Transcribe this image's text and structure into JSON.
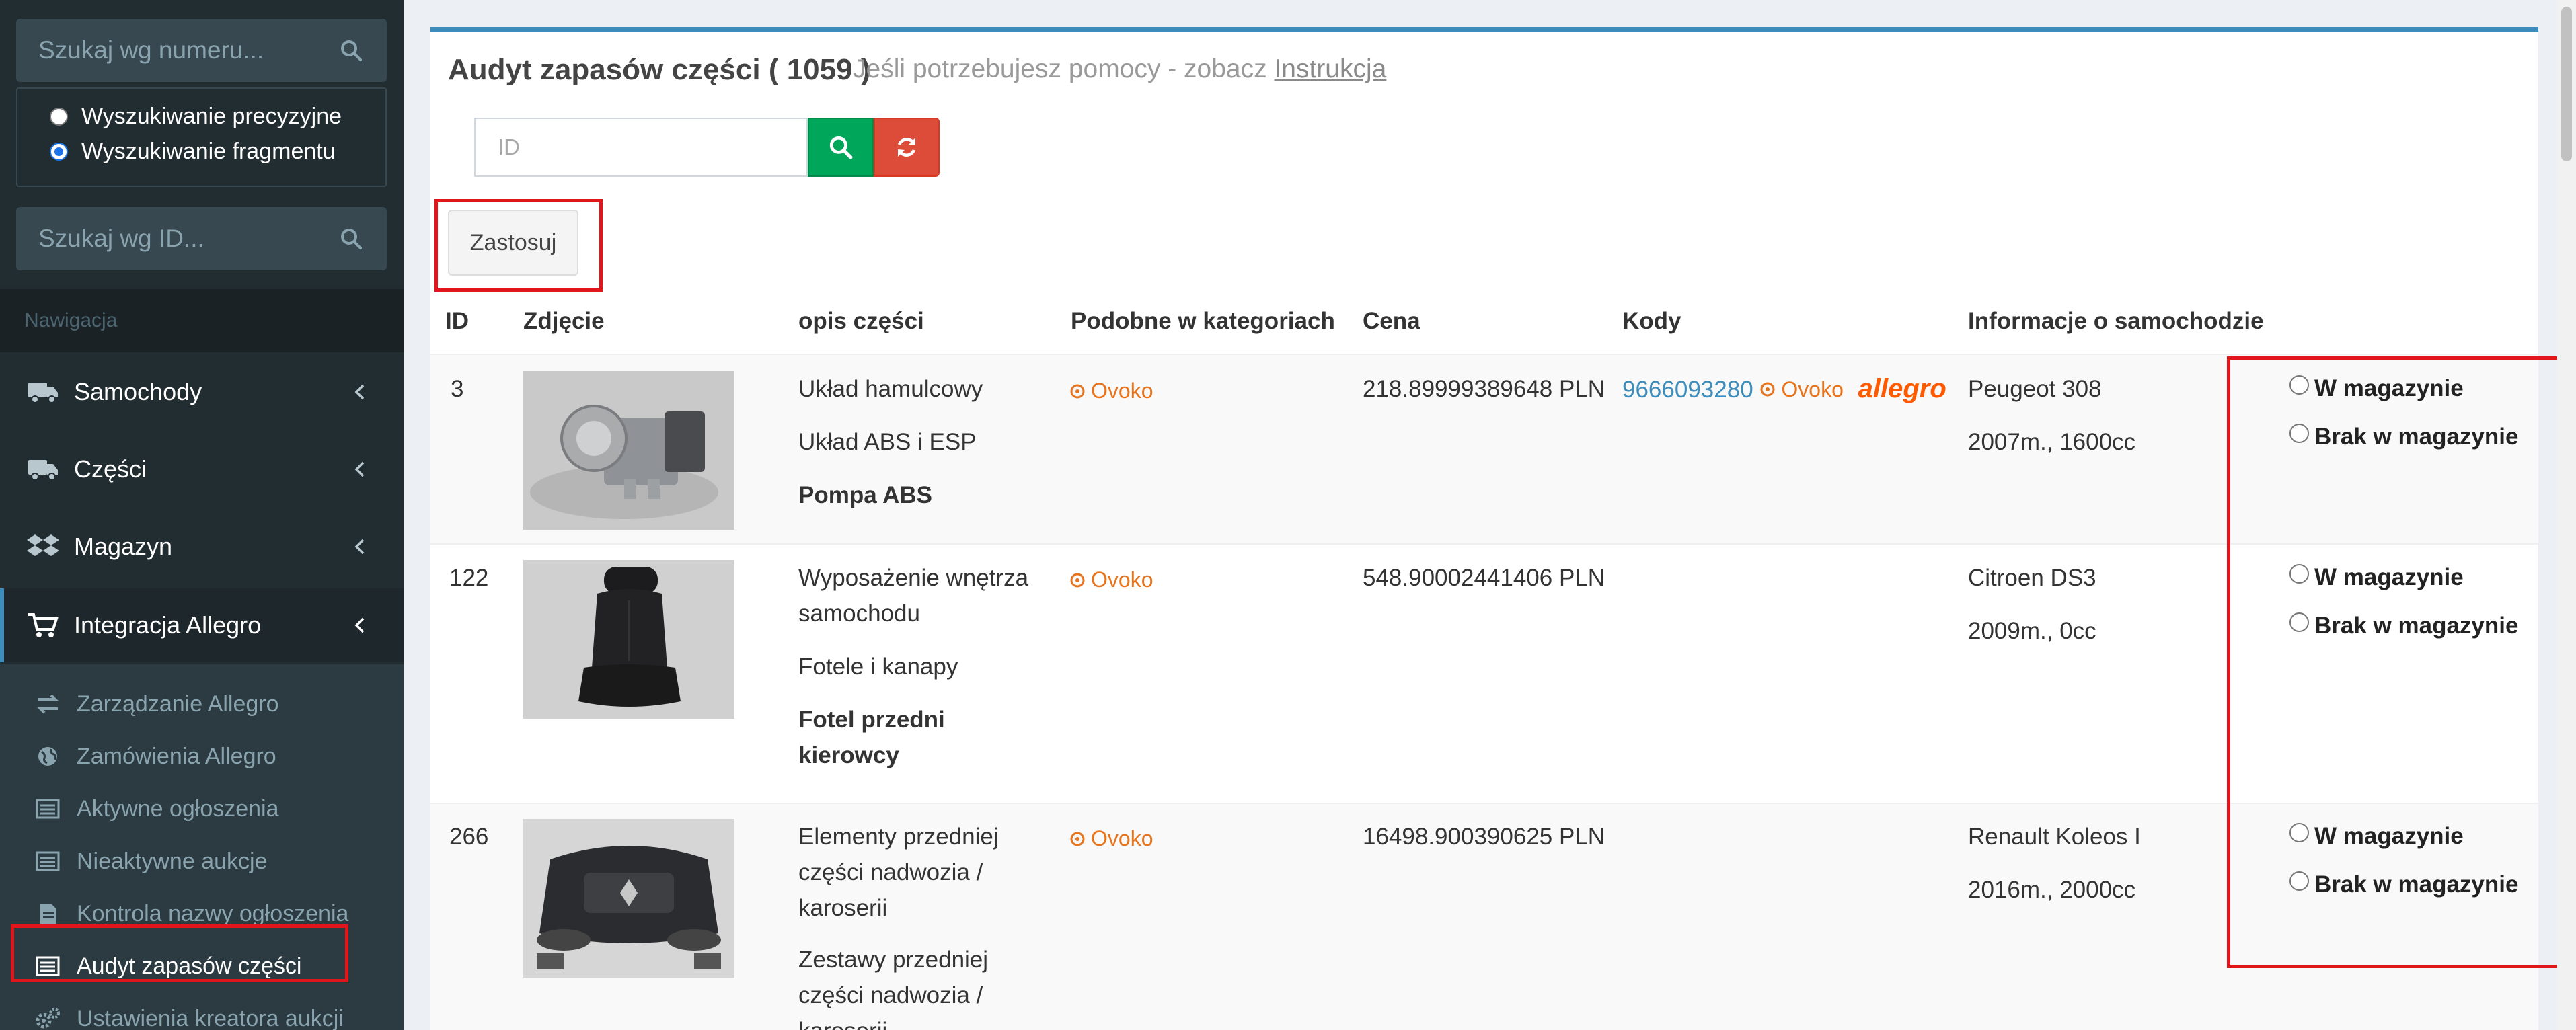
{
  "sidebar": {
    "search_number_placeholder": "Szukaj wg numeru...",
    "search_mode_precise": "Wyszukiwanie precyzyjne",
    "search_mode_fragment": "Wyszukiwanie fragmentu",
    "search_mode_selected": "fragment",
    "search_id_placeholder": "Szukaj wg ID...",
    "nav_header": "Nawigacja",
    "nav_items": [
      {
        "label": "Samochody",
        "icon": "truck-icon"
      },
      {
        "label": "Części",
        "icon": "truck-icon"
      },
      {
        "label": "Magazyn",
        "icon": "dropbox-icon"
      },
      {
        "label": "Integracja Allegro",
        "icon": "cart-icon"
      }
    ],
    "sub_items": [
      {
        "label": "Zarządzanie Allegro",
        "icon": "exchange-icon"
      },
      {
        "label": "Zamówienia Allegro",
        "icon": "globe-icon"
      },
      {
        "label": "Aktywne ogłoszenia",
        "icon": "list-icon"
      },
      {
        "label": "Nieaktywne aukcje",
        "icon": "list-icon"
      },
      {
        "label": "Kontrola nazwy ogłoszenia",
        "icon": "file-icon"
      },
      {
        "label": "Audyt zapasów części",
        "icon": "list-icon"
      },
      {
        "label": "Ustawienia kreatora aukcji",
        "icon": "cogs-icon"
      }
    ]
  },
  "main": {
    "title": "Audyt zapasów części ( 1059 )",
    "help_text": "Jeśli potrzebujesz pomocy - zobacz",
    "help_link": "Instrukcja",
    "id_placeholder": "ID",
    "apply_label": "Zastosuj",
    "columns": [
      "ID",
      "Zdjęcie",
      "opis części",
      "Podobne w kategoriach",
      "Cena",
      "Kody",
      "Informacje o samochodzie"
    ],
    "rows": [
      {
        "id": "3",
        "photo_icon": "abs-pump-photo",
        "category": "Układ hamulcowy",
        "subcategory": "Układ ABS i ESP",
        "part_name": "Pompa ABS",
        "similar": "Ovoko",
        "price": "218.89999389648 PLN",
        "code": "9666093280",
        "code_ovoko": "Ovoko",
        "code_allegro": "allegro",
        "car": "Peugeot 308",
        "car_details": "2007m., 1600cc"
      },
      {
        "id": "122",
        "photo_icon": "car-seat-photo",
        "category": "Wyposażenie wnętrza samochodu",
        "subcategory": "Fotele i kanapy",
        "part_name": "Fotel przedni kierowcy",
        "similar": "Ovoko",
        "price": "548.90002441406 PLN",
        "car": "Citroen DS3",
        "car_details": "2009m., 0cc"
      },
      {
        "id": "266",
        "photo_icon": "front-bumper-photo",
        "category": "Elementy przedniej części nadwozia / karoserii",
        "subcategory": "Zestawy przedniej części nadwozia / karoserii",
        "similar": "Ovoko",
        "price": "16498.900390625 PLN",
        "car": "Renault Koleos I",
        "car_details": "2016m., 2000cc"
      }
    ],
    "stock_in": "W magazynie",
    "stock_out": "Brak w magazynie"
  },
  "colors": {
    "sidebar_bg": "#222d32",
    "accent": "#3c8dbc",
    "search_btn": "#00a65a",
    "refresh_btn": "#dd4b39",
    "highlight": "#e0161c",
    "ovoko": "#e8731a",
    "allegro": "#ff5a00"
  }
}
